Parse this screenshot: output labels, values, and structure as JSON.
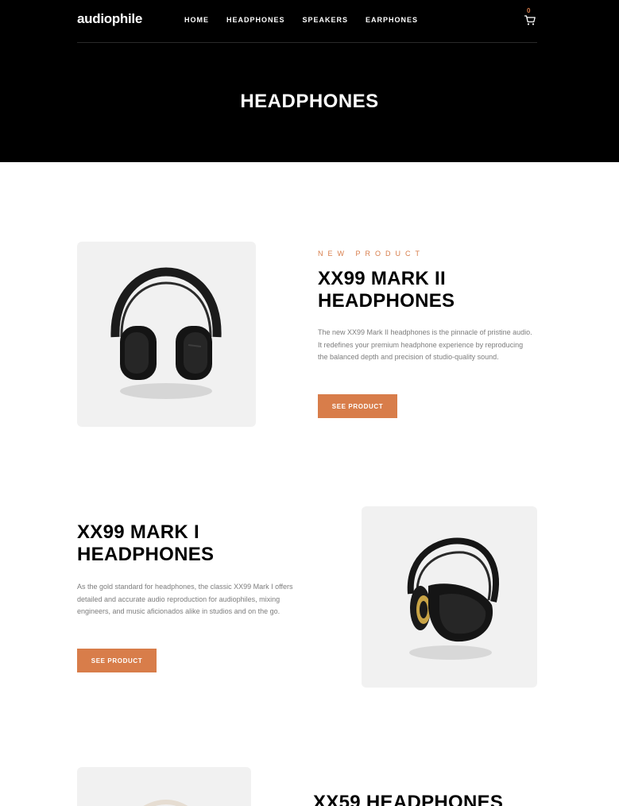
{
  "header": {
    "logo": "audiophile",
    "nav": [
      "HOME",
      "HEADPHONES",
      "SPEAKERS",
      "EARPHONES"
    ],
    "cart_count": "0",
    "cart_icon": "cart-icon"
  },
  "page_title": "HEADPHONES",
  "products": [
    {
      "overline": "NEW PRODUCT",
      "name": "XX99 MARK II\nHEADPHONES",
      "description": "The new XX99 Mark II headphones is the pinnacle of pristine audio. It redefines your premium headphone experience by reproducing the balanced depth and precision of studio-quality sound.",
      "button": "SEE PRODUCT"
    },
    {
      "name": "XX99 MARK I\nHEADPHONES",
      "description": "As the gold standard for headphones, the classic XX99 Mark I offers detailed and accurate audio reproduction for audiophiles, mixing engineers, and music aficionados alike in studios and on the go.",
      "button": "SEE PRODUCT"
    },
    {
      "name": "XX59 HEADPHONES"
    }
  ],
  "colors": {
    "accent": "#d87d4a",
    "hero_bg": "#000000",
    "card_bg": "#f1f1f1",
    "body_text": "#7d7d7d"
  }
}
